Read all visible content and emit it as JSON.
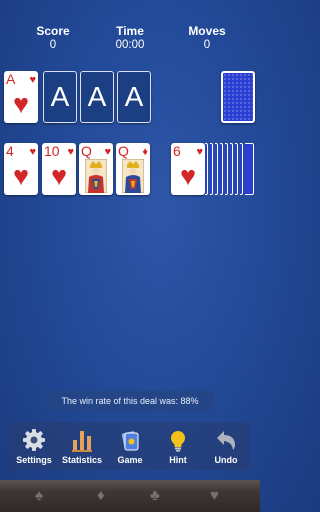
{
  "stats": {
    "score_label": "Score",
    "score_value": "0",
    "time_label": "Time",
    "time_value": "00:00",
    "moves_label": "Moves",
    "moves_value": "0"
  },
  "foundation": [
    {
      "rank": "A",
      "suit": "hearts"
    },
    {
      "rank": "A",
      "suit": "empty"
    },
    {
      "rank": "A",
      "suit": "empty"
    },
    {
      "rank": "A",
      "suit": "empty"
    }
  ],
  "waste": [
    {
      "rank": "4",
      "suit": "hearts"
    },
    {
      "rank": "10",
      "suit": "hearts"
    },
    {
      "rank": "Q",
      "suit": "hearts"
    },
    {
      "rank": "Q",
      "suit": "diamonds"
    }
  ],
  "tableau_top": {
    "rank": "6",
    "suit": "hearts",
    "face_down_stack": 9
  },
  "info": {
    "win_rate_text": "The win rate of this deal was: 88%"
  },
  "toolbar": [
    {
      "label": "Settings",
      "icon": "gear-icon"
    },
    {
      "label": "Statistics",
      "icon": "bar-chart-icon"
    },
    {
      "label": "Game",
      "icon": "cards-icon"
    },
    {
      "label": "Hint",
      "icon": "lightbulb-icon"
    },
    {
      "label": "Undo",
      "icon": "undo-arrow-icon"
    }
  ],
  "colors": {
    "table_felt": "#234a98",
    "card_red": "#d32626",
    "card_back": "#2a3ed1",
    "hint_yellow": "#f3c21a"
  }
}
